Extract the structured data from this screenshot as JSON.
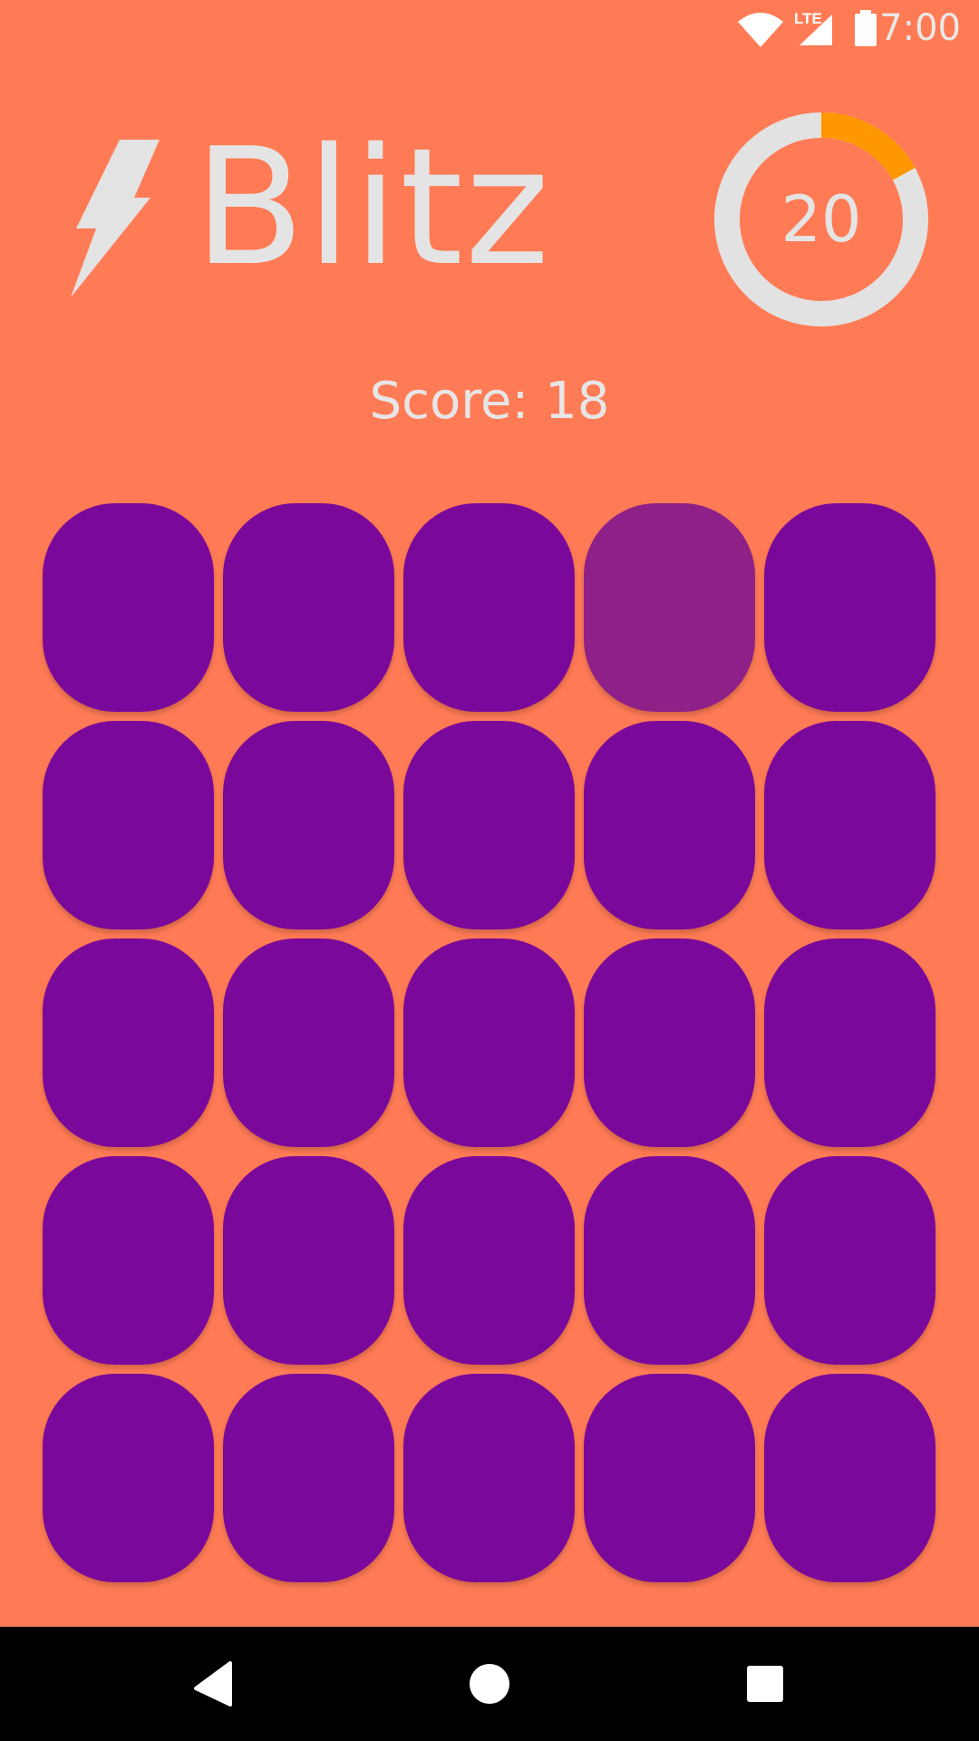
{
  "status_bar": {
    "time": "7:00",
    "network_label": "LTE",
    "icons": [
      "wifi-icon",
      "lte-signal-icon",
      "battery-icon"
    ]
  },
  "header": {
    "title": "Blitz",
    "logo_icon": "lightning-bolt-icon"
  },
  "timer": {
    "value": "20",
    "remaining_fraction": 0.83,
    "colors": {
      "track": "#e2e2e2",
      "elapsed": "#ff9800"
    }
  },
  "score": {
    "text": "Score: 18",
    "value": 18
  },
  "grid": {
    "rows": 5,
    "cols": 5,
    "highlighted": [
      [
        0,
        3
      ]
    ],
    "colors": {
      "tile": "#7a089a",
      "tile_highlighted": "#8e2088"
    }
  },
  "colors": {
    "background": "#ff7b55",
    "text": "#e4e4e4",
    "nav_bar": "#000000"
  },
  "nav_bar": {
    "buttons": [
      "back-icon",
      "home-icon",
      "recents-icon"
    ]
  }
}
